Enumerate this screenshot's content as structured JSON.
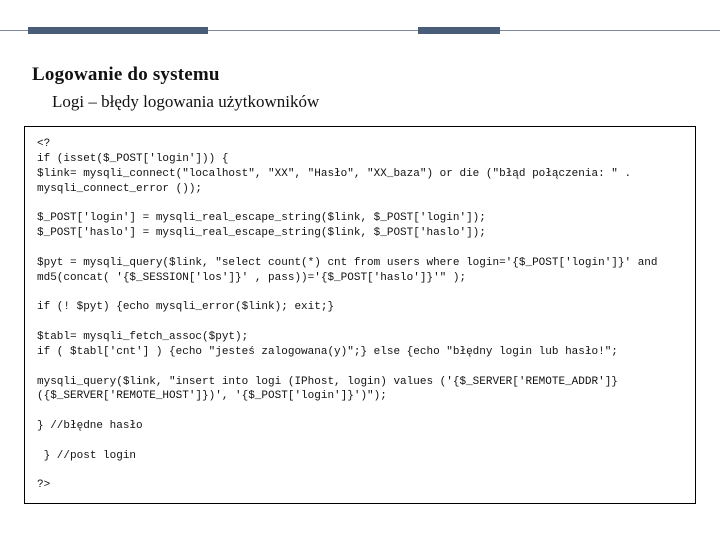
{
  "heading": "Logowanie do systemu",
  "subheading": "Logi – błędy logowania użytkowników",
  "code": "<?\nif (isset($_POST['login'])) {\n$link= mysqli_connect(\"localhost\", \"XX\", \"Hasło\", \"XX_baza\") or die (\"błąd połączenia: \" . mysqli_connect_error ());\n\n$_POST['login'] = mysqli_real_escape_string($link, $_POST['login']);\n$_POST['haslo'] = mysqli_real_escape_string($link, $_POST['haslo']);\n\n$pyt = mysqli_query($link, \"select count(*) cnt from users where login='{$_POST['login']}' and md5(concat( '{$_SESSION['los']}' , pass))='{$_POST['haslo']}'\" );\n\nif (! $pyt) {echo mysqli_error($link); exit;}\n\n$tabl= mysqli_fetch_assoc($pyt);\nif ( $tabl['cnt'] ) {echo \"jesteś zalogowana(y)\";} else {echo \"błędny login lub hasło!\";\n\nmysqli_query($link, \"insert into logi (IPhost, login) values ('{$_SERVER['REMOTE_ADDR']}({$_SERVER['REMOTE_HOST']})', '{$_POST['login']}')\");\n\n} //błędne hasło\n\n } //post login\n\n?>"
}
